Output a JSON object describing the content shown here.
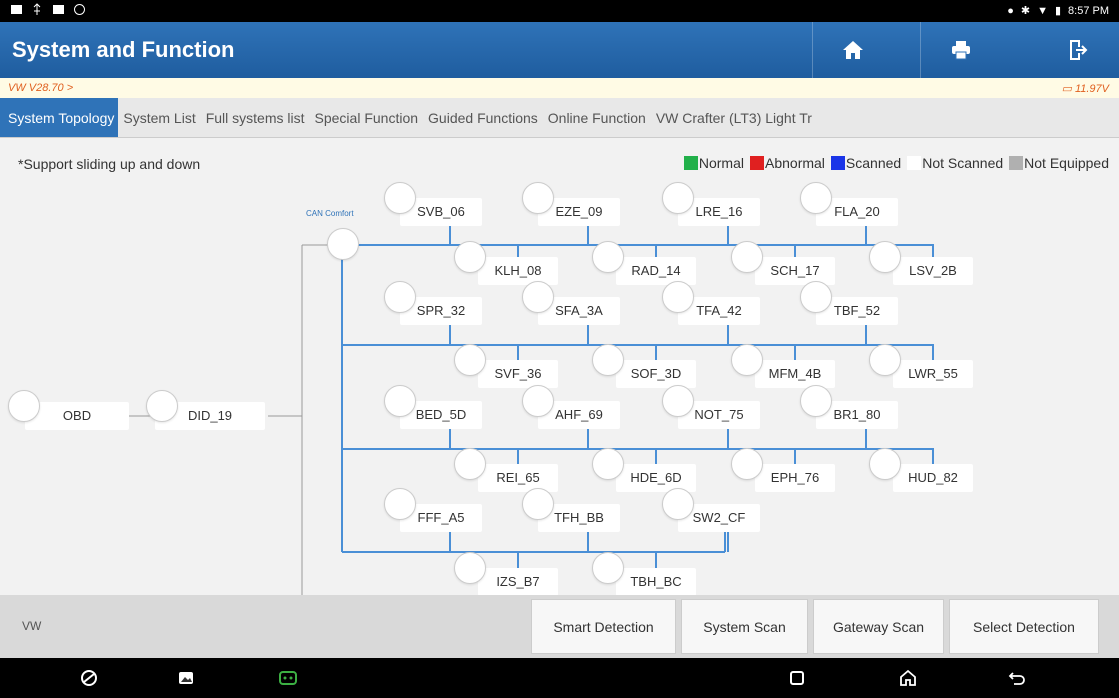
{
  "status_bar": {
    "time": "8:57 PM"
  },
  "header": {
    "title": "System and Function"
  },
  "info_bar": {
    "version": "VW V28.70 >",
    "voltage": "11.97V"
  },
  "tabs": [
    "System Topology",
    "System List",
    "Full systems list",
    "Special Function",
    "Guided Functions",
    "Online Function",
    "VW Crafter (LT3) Light Tr"
  ],
  "active_tab": "System Topology",
  "topology": {
    "hint": "*Support sliding up and down",
    "legend": [
      {
        "label": "Normal",
        "color": "#22b04a"
      },
      {
        "label": "Abnormal",
        "color": "#e02020"
      },
      {
        "label": "Scanned",
        "color": "#1a35e8"
      },
      {
        "label": "Not Scanned",
        "color": "#ffffff"
      },
      {
        "label": "Not Equipped",
        "color": "#b0b0b0"
      }
    ],
    "bus_label": "CAN Comfort",
    "root_nodes": [
      "OBD",
      "DID_19"
    ],
    "modules": [
      "SVB_06",
      "EZE_09",
      "LRE_16",
      "FLA_20",
      "KLH_08",
      "RAD_14",
      "SCH_17",
      "LSV_2B",
      "SPR_32",
      "SFA_3A",
      "TFA_42",
      "TBF_52",
      "SVF_36",
      "SOF_3D",
      "MFM_4B",
      "LWR_55",
      "BED_5D",
      "AHF_69",
      "NOT_75",
      "BR1_80",
      "REI_65",
      "HDE_6D",
      "EPH_76",
      "HUD_82",
      "FFF_A5",
      "TFH_BB",
      "SW2_CF",
      "IZS_B7",
      "TBH_BC"
    ]
  },
  "bottom": {
    "brand": "VW",
    "buttons": [
      "Smart Detection",
      "System Scan",
      "Gateway Scan",
      "Select Detection"
    ]
  },
  "colors": {
    "header": "#2f73b8",
    "line": "#4a8fd6",
    "accent_orange": "#e06020"
  }
}
